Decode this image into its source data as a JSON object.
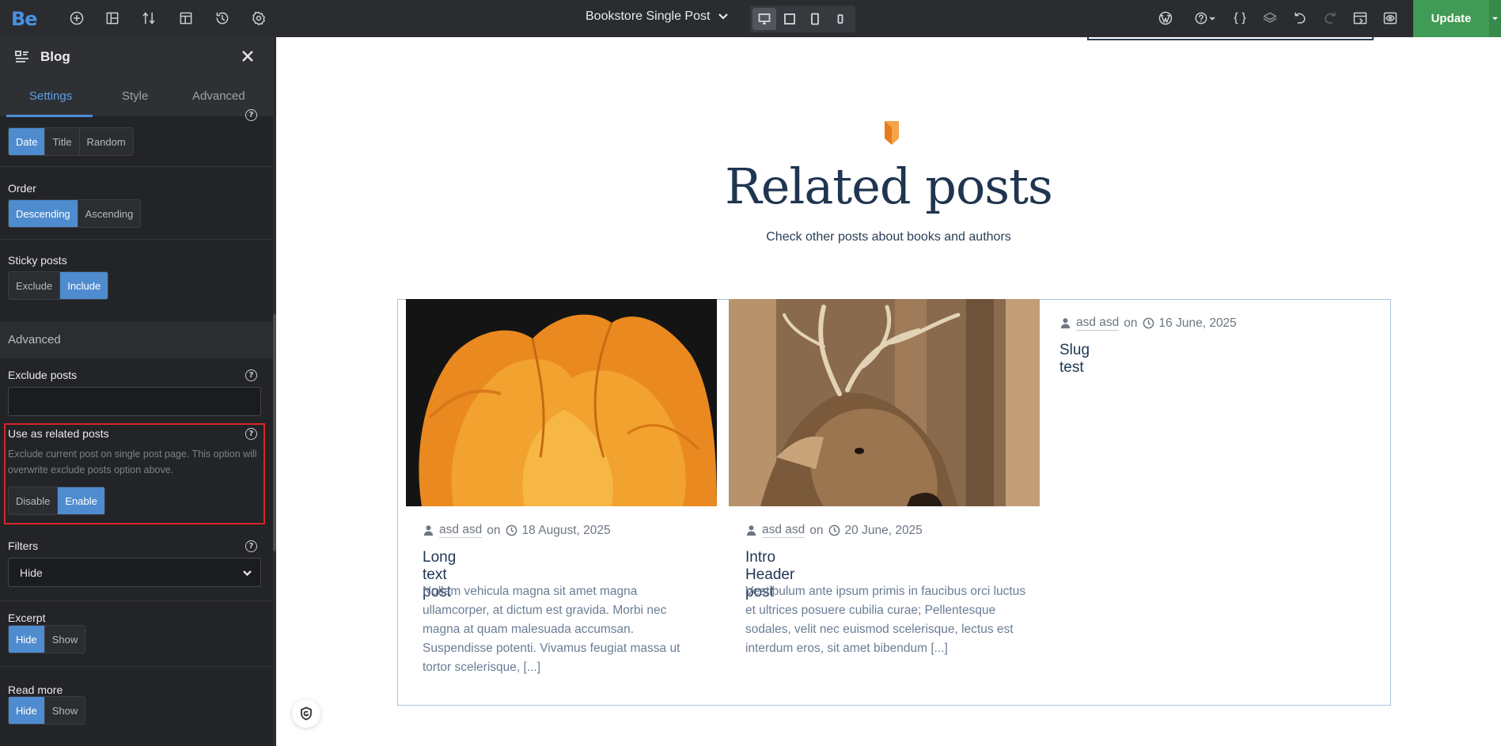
{
  "topbar": {
    "logo": "Be",
    "page_name": "Bookstore Single Post",
    "update_label": "Update",
    "left_icons": [
      "plus-circle-icon",
      "layout-icon",
      "sort-icon",
      "template-icon",
      "history-icon",
      "settings-icon"
    ],
    "right_icons": [
      "wordpress-icon",
      "help-icon",
      "css-icon",
      "layers-icon",
      "undo-icon",
      "redo-icon",
      "preview-icon",
      "eye-icon"
    ],
    "devices": [
      "desktop",
      "tablet",
      "mobile-landscape",
      "mobile"
    ],
    "active_device": "desktop",
    "accent_update": "#3f9b55"
  },
  "sidebar": {
    "title": "Blog",
    "tabs": [
      "Settings",
      "Style",
      "Advanced"
    ],
    "active_tab": "Settings",
    "orderby": {
      "options": [
        "Date",
        "Title",
        "Random"
      ],
      "selected": "Date"
    },
    "order": {
      "label": "Order",
      "options": [
        "Descending",
        "Ascending"
      ],
      "selected": "Descending"
    },
    "sticky": {
      "label": "Sticky posts",
      "options": [
        "Exclude",
        "Include"
      ],
      "selected": "Include"
    },
    "advanced_heading": "Advanced",
    "exclude_posts": {
      "label": "Exclude posts",
      "value": ""
    },
    "related": {
      "label": "Use as related posts",
      "description": "Exclude current post on single post page. This option will overwrite exclude posts option above.",
      "options": [
        "Disable",
        "Enable"
      ],
      "selected": "Enable"
    },
    "filters": {
      "label": "Filters",
      "value": "Hide"
    },
    "excerpt": {
      "label": "Excerpt",
      "options": [
        "Hide",
        "Show"
      ],
      "selected": "Hide"
    },
    "readmore": {
      "label": "Read more",
      "options": [
        "Hide",
        "Show"
      ],
      "selected": "Hide"
    },
    "accent": "#4f8ccf"
  },
  "canvas": {
    "heading": "Related posts",
    "subheading": "Check other posts about books and authors",
    "posts": [
      {
        "author": "asd asd",
        "on": "on",
        "date": "18 August, 2025",
        "title": "Long text post",
        "excerpt": "Nullam vehicula magna sit amet magna ullamcorper, at dictum est gravida. Morbi nec magna at quam malesuada accumsan. Suspendisse potenti. Vivamus feugiat massa ut tortor scelerisque, [...]",
        "image": "orange-tulip"
      },
      {
        "author": "asd asd",
        "on": "on",
        "date": "20 June, 2025",
        "title": "Intro Header post",
        "excerpt": "Vestibulum ante ipsum primis in faucibus orci luctus et ultrices posuere cubilia curae; Pellentesque sodales, velit nec euismod scelerisque, lectus est interdum eros, sit amet bibendum [...]",
        "image": "deer"
      },
      {
        "author": "asd asd",
        "on": "on",
        "date": "16 June, 2025",
        "title": "Slug test",
        "excerpt": "",
        "image": ""
      }
    ],
    "title_color": "#1f3550",
    "book_icon_color": "#f08a2c"
  }
}
